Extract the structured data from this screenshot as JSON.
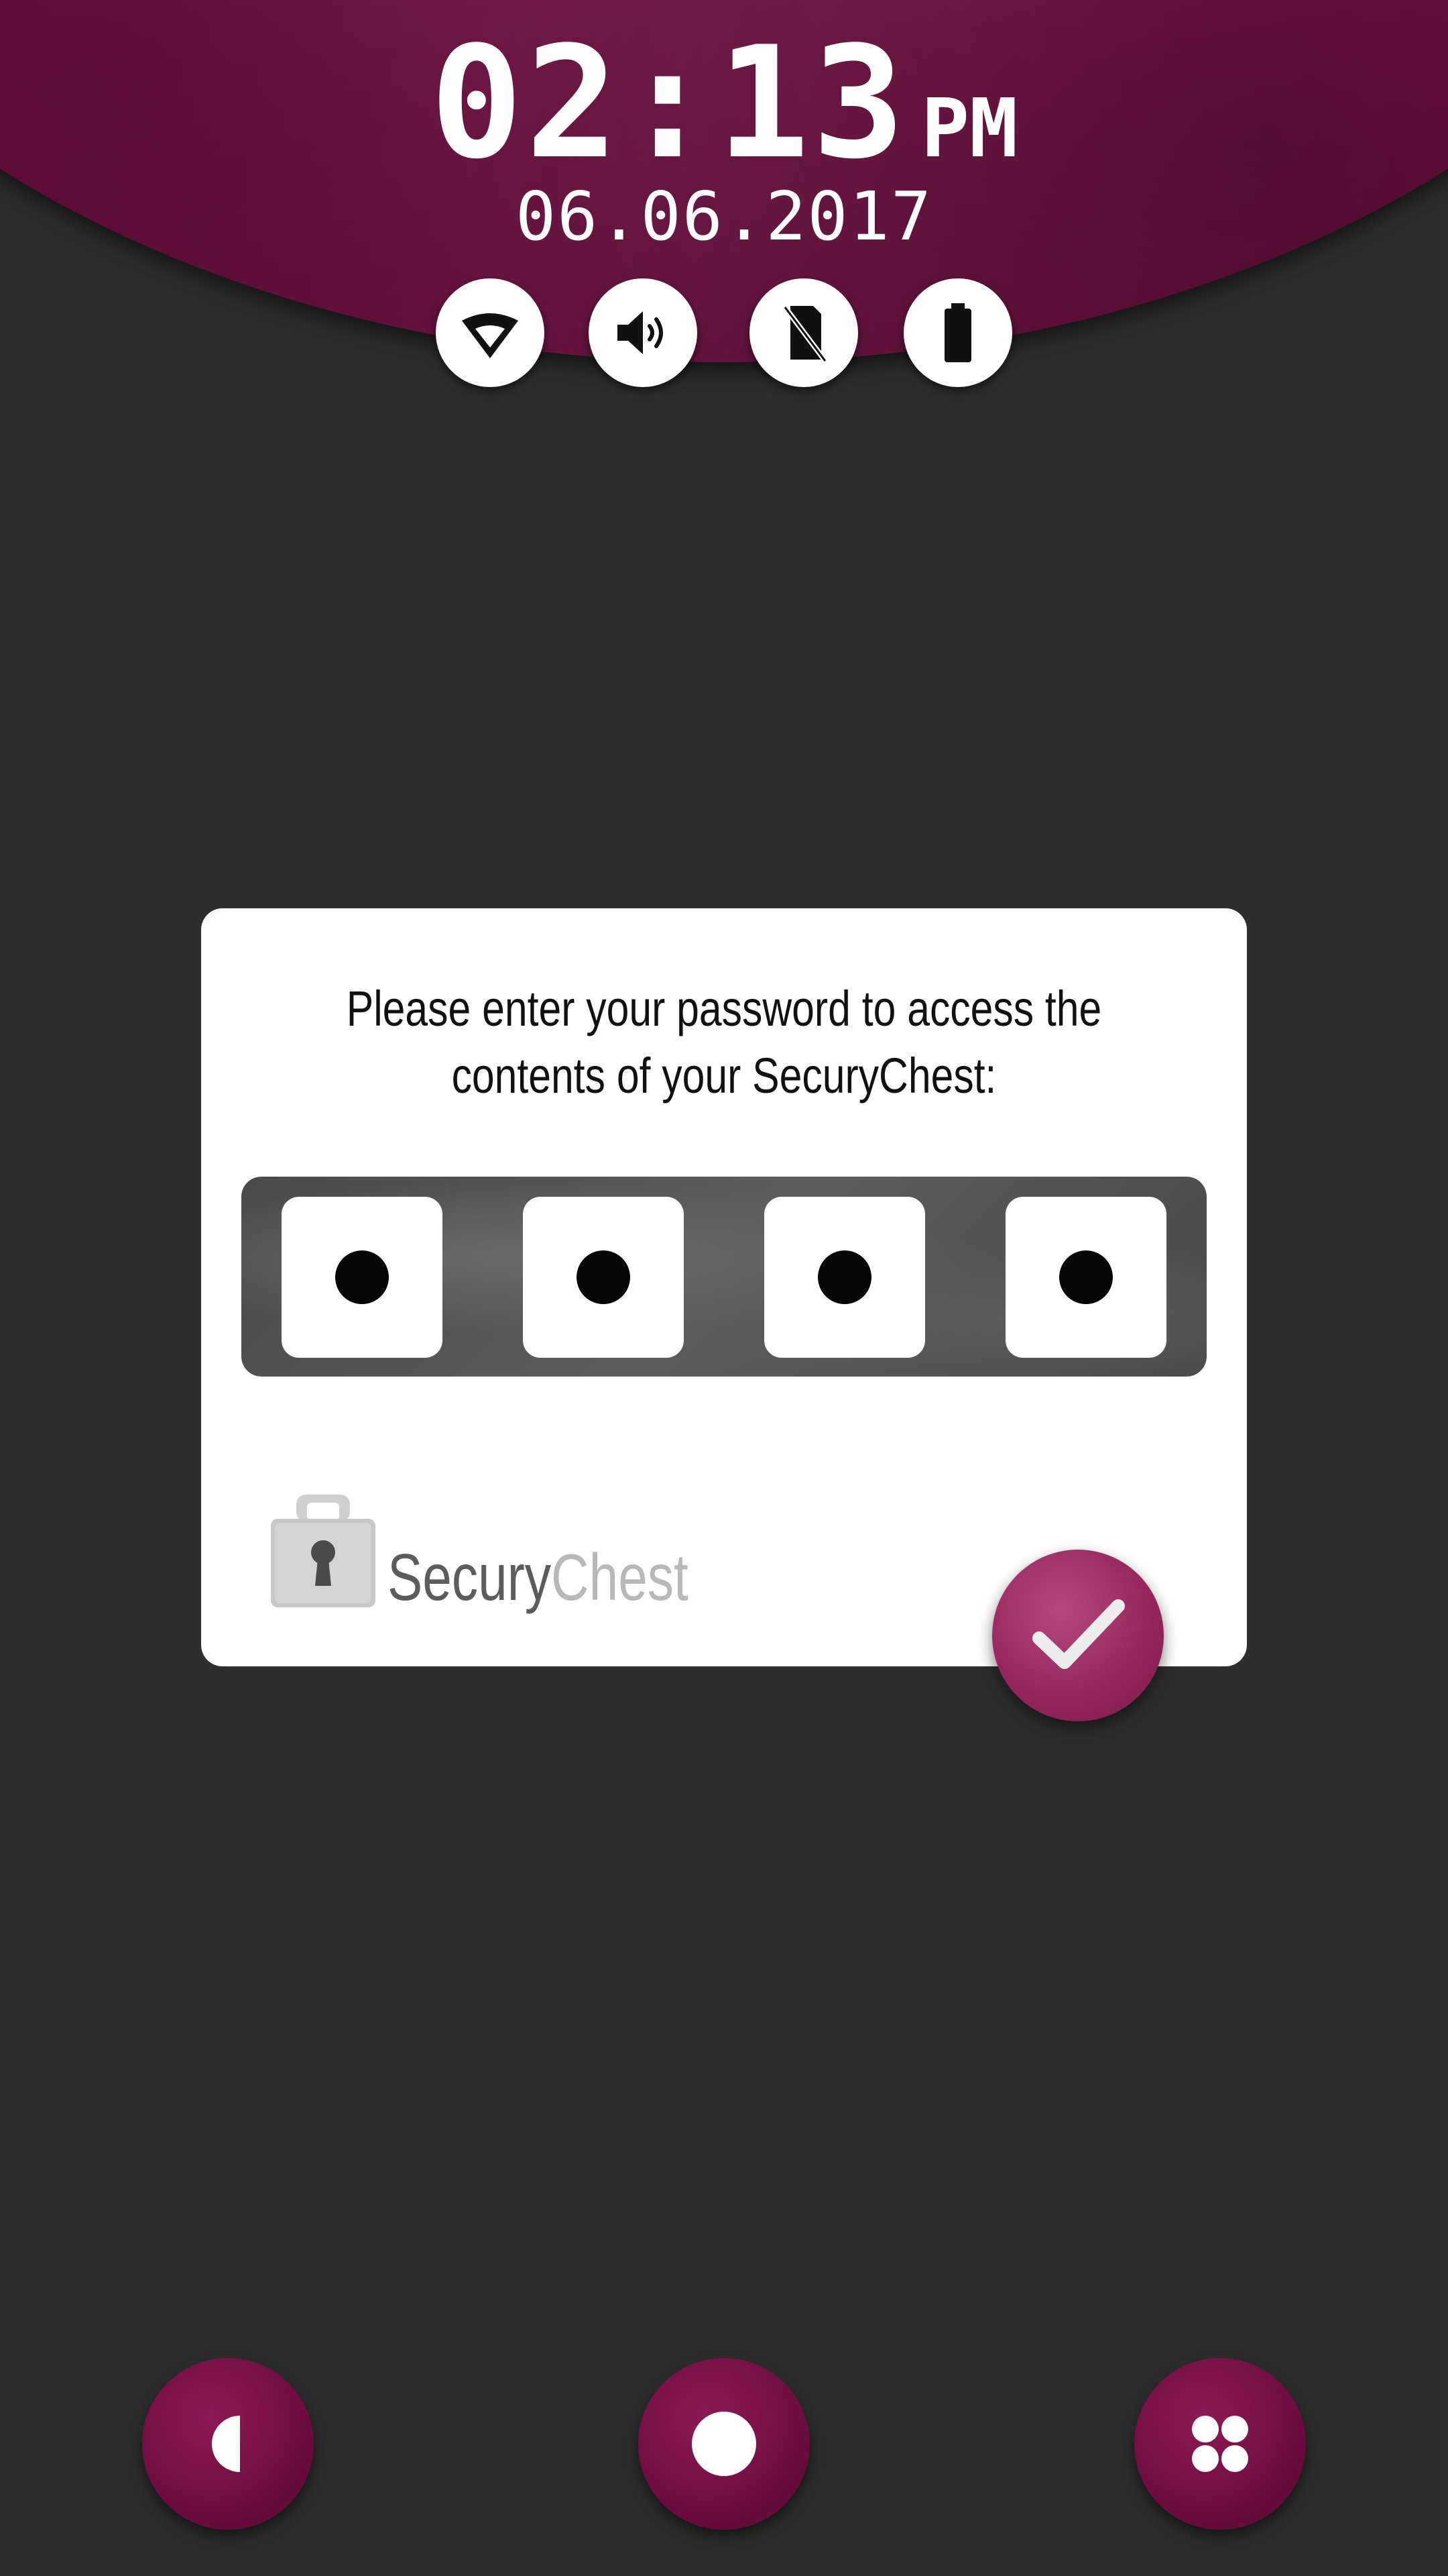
{
  "status_bar": {
    "time": "02:13",
    "ampm": "PM",
    "date": "06.06.2017",
    "icons": [
      "wifi-icon",
      "volume-icon",
      "no-sim-icon",
      "battery-icon"
    ]
  },
  "dialog": {
    "message": "Please enter your password to access the contents of your SecuryChest:",
    "pin_slots": 4,
    "brand_part1": "Secury",
    "brand_part2": "Chest"
  },
  "colors": {
    "accent": "#8c1655",
    "confirm": "#96285f",
    "background": "#2e2e2e"
  },
  "nav": {
    "buttons": [
      "back-icon",
      "home-icon",
      "apps-icon"
    ]
  }
}
